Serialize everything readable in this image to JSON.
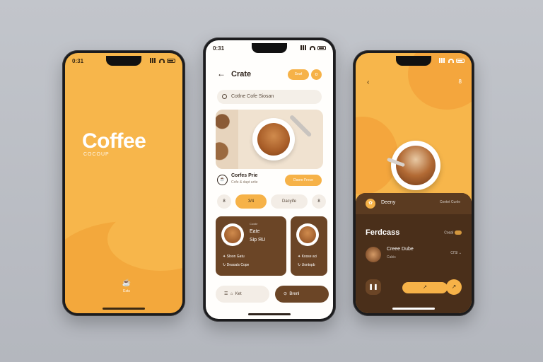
{
  "splash": {
    "status_time": "0:31",
    "title": "Coffee",
    "subtitle": "COCOUP",
    "logo_icon": "coffee-cup-icon",
    "logo_label": "Ests"
  },
  "list_screen": {
    "status_time": "0:31",
    "back_icon": "←",
    "title": "Crate",
    "header_pill": "Sowl",
    "header_circle": "o",
    "search_placeholder": "Cotlne Cofe Siosan",
    "featured_item": {
      "name": "Corfes Prie",
      "desc": "Cofe & dapt artie",
      "button": "Daore Frece"
    },
    "chips": [
      "8",
      "3/4",
      "Dacyife",
      "8"
    ],
    "cards": [
      {
        "tiny": "Cowbr",
        "name": "Eate",
        "price": "Sip ЯU",
        "row1": "Sloon Gatu",
        "row2": "Deaoals Cope"
      },
      {
        "tiny": "",
        "name": "",
        "price": "",
        "row1": "Kosse aci",
        "row2": "Uontopb"
      }
    ],
    "nav": {
      "left": "Ket",
      "right": "Brenl"
    }
  },
  "detail_screen": {
    "status_time": "",
    "back_icon": "‹",
    "more_icon": "8",
    "tab_label": "Deeny",
    "tab_right": "Coetet Cunle",
    "section_title": "Ferdcass",
    "section_right": "Cosal",
    "row": {
      "title": "Creee Dube",
      "sub": "Cabis",
      "right": "Cl'Sl"
    },
    "controls": {
      "pause": "❚❚",
      "mid": "↗",
      "go": "↗"
    }
  },
  "colors": {
    "amber": "#f7b64b",
    "brown": "#6b4526",
    "dark_brown": "#4a2f1a",
    "background": "#b9bcc3"
  }
}
